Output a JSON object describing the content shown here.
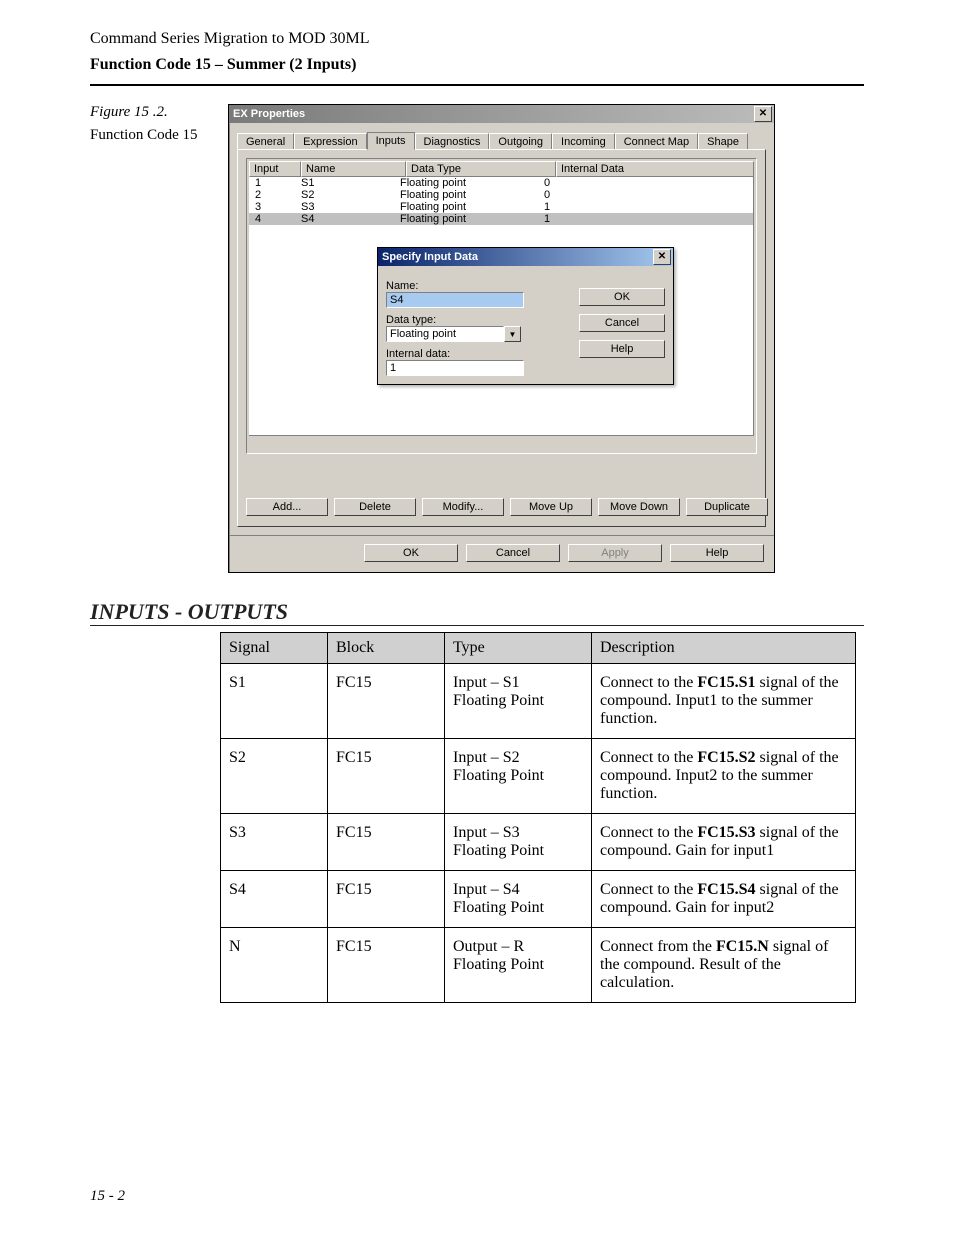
{
  "doc": {
    "header": "Command Series Migration to MOD 30ML",
    "section": "Function Code 15 – Summer (2 Inputs)",
    "figure_label": "Figure 15 .2.",
    "figure_caption": "Function Code 15",
    "page_num": "15 - 2"
  },
  "dlg": {
    "title": "EX Properties",
    "close": "✕",
    "tabs": [
      "General",
      "Expression",
      "Inputs",
      "Diagnostics",
      "Outgoing",
      "Incoming",
      "Connect Map",
      "Shape"
    ],
    "active_tab": "Inputs",
    "cols": {
      "input": "Input",
      "name": "Name",
      "type": "Data Type",
      "data": "Internal Data"
    },
    "rows": [
      {
        "i": "1",
        "n": "S1",
        "t": "Floating point",
        "d": "0"
      },
      {
        "i": "2",
        "n": "S2",
        "t": "Floating point",
        "d": "0"
      },
      {
        "i": "3",
        "n": "S3",
        "t": "Floating point",
        "d": "1"
      },
      {
        "i": "4",
        "n": "S4",
        "t": "Floating point",
        "d": "1"
      }
    ],
    "selected_row": 3,
    "row_buttons": [
      "Add...",
      "Delete",
      "Modify...",
      "Move Up",
      "Move Down",
      "Duplicate"
    ],
    "main_buttons": {
      "ok": "OK",
      "cancel": "Cancel",
      "apply": "Apply",
      "help": "Help"
    }
  },
  "inner": {
    "title": "Specify Input Data",
    "close": "✕",
    "labels": {
      "name": "Name:",
      "type": "Data type:",
      "data": "Internal data:"
    },
    "values": {
      "name": "S4",
      "type": "Floating point",
      "data": "1"
    },
    "drop_glyph": "▼",
    "buttons": {
      "ok": "OK",
      "cancel": "Cancel",
      "help": "Help"
    }
  },
  "io": {
    "title": "INPUTS - OUTPUTS",
    "cols": {
      "signal": "Signal",
      "block": "Block",
      "type": "Type",
      "desc": "Description"
    },
    "rows": [
      {
        "signal": "S1",
        "block": "FC15",
        "type": "Input – S1\nFloating Point",
        "desc_pre": "Connect to the ",
        "desc_bold": "FC15.S1",
        "desc_post": " signal of the compound. Input1 to the summer function."
      },
      {
        "signal": "S2",
        "block": "FC15",
        "type": "Input – S2\nFloating Point",
        "desc_pre": "Connect to the ",
        "desc_bold": "FC15.S2",
        "desc_post": " signal of the compound. Input2 to the summer function."
      },
      {
        "signal": "S3",
        "block": "FC15",
        "type": "Input –  S3\nFloating Point",
        "desc_pre": "Connect to the ",
        "desc_bold": "FC15.S3",
        "desc_post": " signal of the compound. Gain for input1"
      },
      {
        "signal": "S4",
        "block": "FC15",
        "type": "Input –  S4\nFloating Point",
        "desc_pre": "Connect to the ",
        "desc_bold": "FC15.S4",
        "desc_post": " signal of the compound. Gain for input2"
      },
      {
        "signal": "N",
        "block": "FC15",
        "type": "Output – R\nFloating Point",
        "desc_pre": "Connect from the ",
        "desc_bold": "FC15.N",
        "desc_post": " signal of the compound. Result of the calculation."
      }
    ]
  }
}
